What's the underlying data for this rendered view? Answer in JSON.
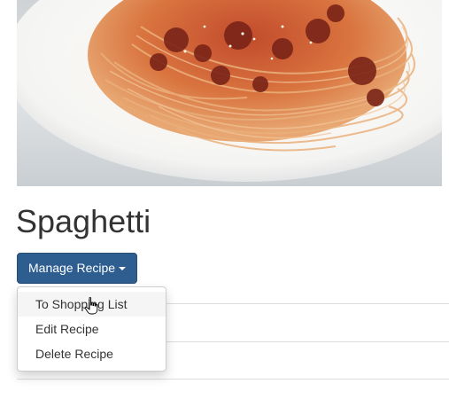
{
  "recipe": {
    "title": "Spaghetti",
    "image": {
      "icon": "spaghetti-photo"
    }
  },
  "actions": {
    "manage_label": "Manage Recipe",
    "menu_items": [
      {
        "label": "To Shopping List",
        "hovered": true
      },
      {
        "label": "Edit Recipe",
        "hovered": false
      },
      {
        "label": "Delete Recipe",
        "hovered": false
      }
    ]
  },
  "colors": {
    "primary_button": "#2e5d8f",
    "hover_item": "#f5f5f5",
    "sauce": "#b8432a",
    "pasta": "#e3a06a"
  }
}
